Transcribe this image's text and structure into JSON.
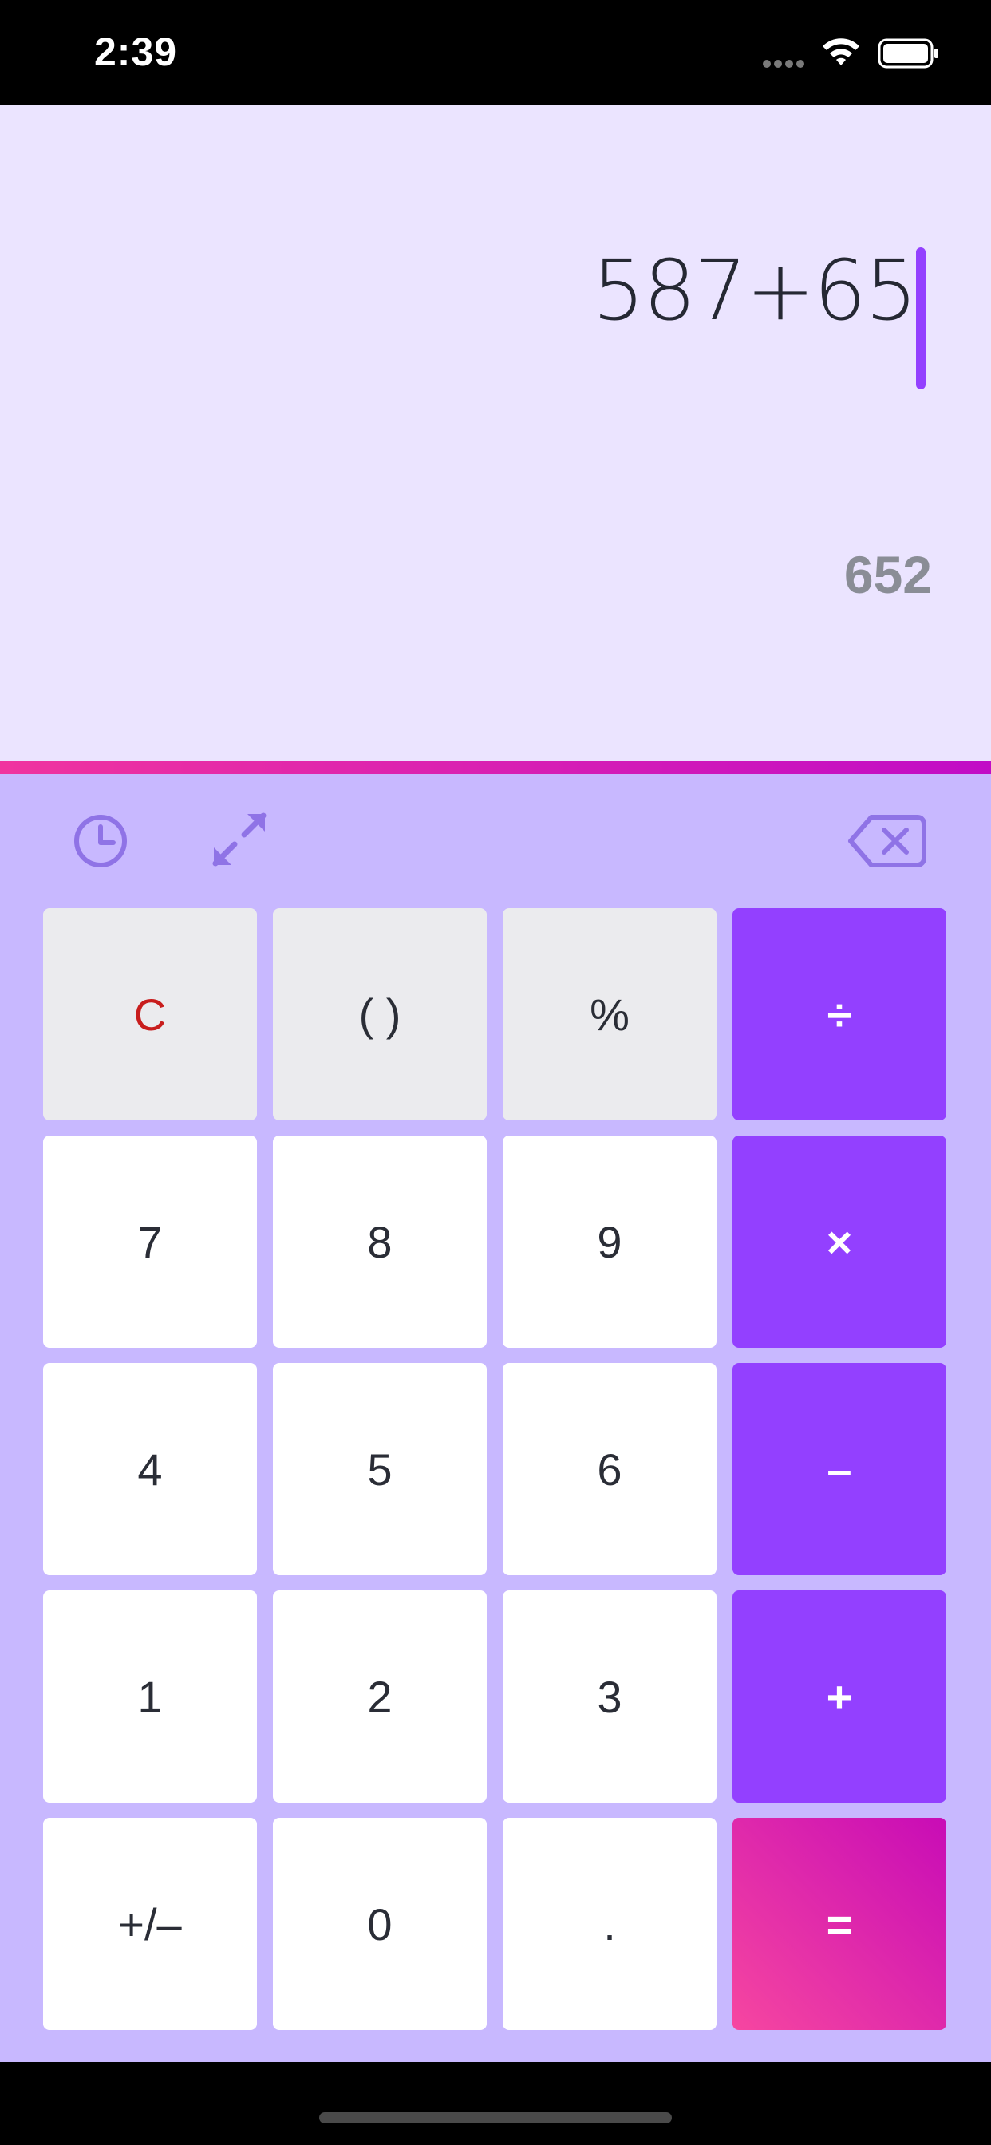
{
  "status_bar": {
    "time": "2:39"
  },
  "display": {
    "expression": "587+65",
    "result": "652"
  },
  "toolbar": {
    "icons": [
      "history-icon",
      "expand-icon",
      "backspace-icon"
    ]
  },
  "keys": {
    "clear": "C",
    "parentheses": "( )",
    "percent": "%",
    "divide": "÷",
    "seven": "7",
    "eight": "8",
    "nine": "9",
    "multiply": "×",
    "four": "4",
    "five": "5",
    "six": "6",
    "minus": "–",
    "one": "1",
    "two": "2",
    "three": "3",
    "plus": "+",
    "sign": "+/–",
    "zero": "0",
    "decimal": ".",
    "equals": "="
  },
  "colors": {
    "display_bg": "#ebe4ff",
    "keypad_bg": "#c8b8ff",
    "operator": "#9340ff",
    "equals_gradient": [
      "#f646a0",
      "#c80cb6"
    ],
    "clear_text": "#c81d1d",
    "cursor": "#9340ff"
  }
}
